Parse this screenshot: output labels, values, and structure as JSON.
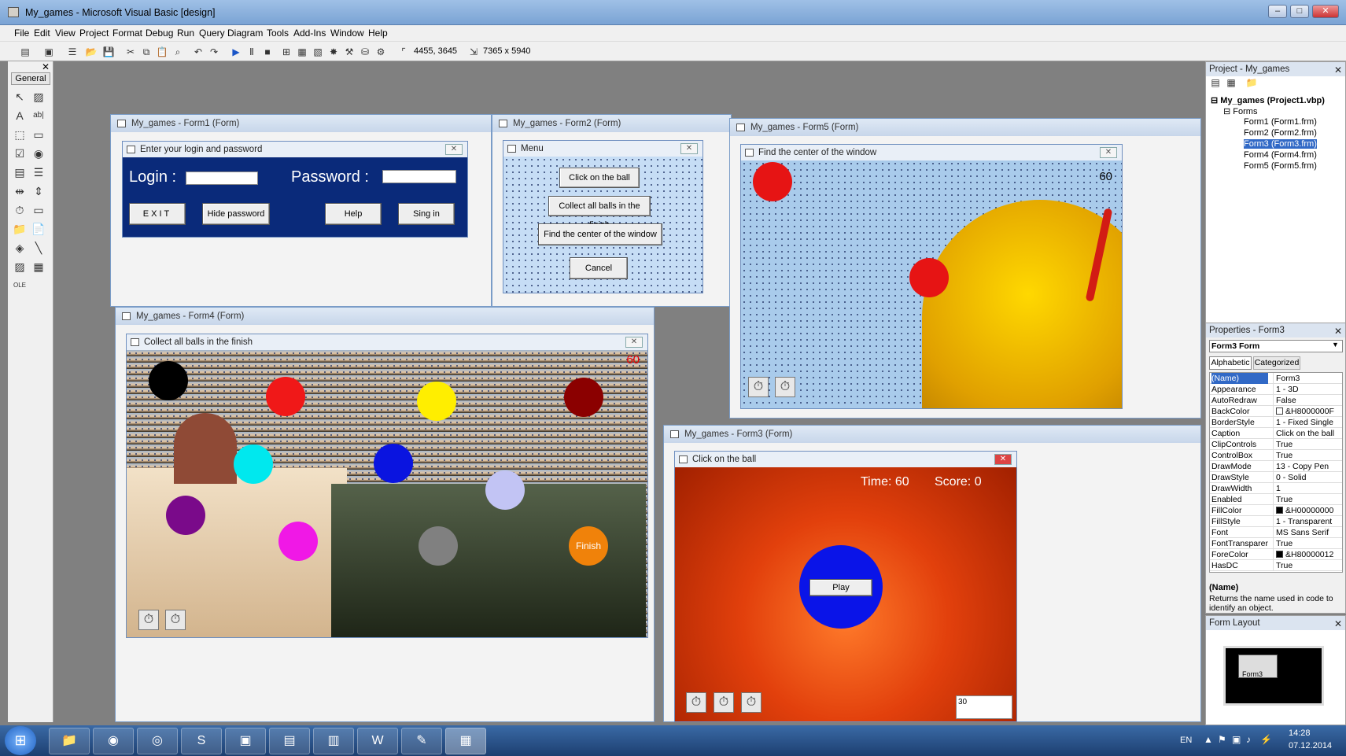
{
  "window": {
    "title": "My_games - Microsoft Visual Basic [design]",
    "min": "–",
    "max": "□",
    "close": "✕"
  },
  "menu": [
    "File",
    "Edit",
    "View",
    "Project",
    "Format",
    "Debug",
    "Run",
    "Query",
    "Diagram",
    "Tools",
    "Add-Ins",
    "Window",
    "Help"
  ],
  "toolbar": {
    "position": "4455, 3645",
    "size": "7365 x 5940"
  },
  "toolbox": {
    "title": "General"
  },
  "form1": {
    "outer": "My_games - Form1 (Form)",
    "caption": "Enter your login and password",
    "login_label": "Login :",
    "password_label": "Password :",
    "exit": "EXIT",
    "hide": "Hide password",
    "help": "Help",
    "sign": "Sing in"
  },
  "form2": {
    "outer": "My_games - Form2 (Form)",
    "caption": "Menu",
    "b1": "Click on the ball",
    "b2": "Collect all balls in the finish",
    "b3": "Find the center of the window",
    "b4": "Cancel"
  },
  "form5": {
    "outer": "My_games - Form5 (Form)",
    "caption": "Find the center of the window",
    "counter": "60"
  },
  "form4": {
    "outer": "My_games - Form4 (Form)",
    "caption": "Collect all balls in the finish",
    "counter": "60",
    "finish": "Finish"
  },
  "form3": {
    "outer": "My_games - Form3 (Form)",
    "caption": "Click on the ball",
    "time": "Time: 60",
    "score": "Score:  0",
    "play": "Play",
    "input": "30"
  },
  "project": {
    "title": "Project - My_games",
    "root": "My_games (Project1.vbp)",
    "folder": "Forms",
    "items": [
      "Form1 (Form1.frm)",
      "Form2 (Form2.frm)",
      "Form3 (Form3.frm)",
      "Form4 (Form4.frm)",
      "Form5 (Form5.frm)"
    ]
  },
  "properties": {
    "title": "Properties - Form3",
    "object": "Form3 Form",
    "tab1": "Alphabetic",
    "tab2": "Categorized",
    "rows": [
      [
        "(Name)",
        "Form3"
      ],
      [
        "Appearance",
        "1 - 3D"
      ],
      [
        "AutoRedraw",
        "False"
      ],
      [
        "BackColor",
        "&H8000000F"
      ],
      [
        "BorderStyle",
        "1 - Fixed Single"
      ],
      [
        "Caption",
        "Click on the ball"
      ],
      [
        "ClipControls",
        "True"
      ],
      [
        "ControlBox",
        "True"
      ],
      [
        "DrawMode",
        "13 - Copy Pen"
      ],
      [
        "DrawStyle",
        "0 - Solid"
      ],
      [
        "DrawWidth",
        "1"
      ],
      [
        "Enabled",
        "True"
      ],
      [
        "FillColor",
        "&H00000000"
      ],
      [
        "FillStyle",
        "1 - Transparent"
      ],
      [
        "Font",
        "MS Sans Serif"
      ],
      [
        "FontTransparent",
        "True"
      ],
      [
        "ForeColor",
        "&H80000012"
      ],
      [
        "HasDC",
        "True"
      ]
    ],
    "desc_title": "(Name)",
    "desc_text": "Returns the name used in code to identify an object."
  },
  "layout": {
    "title": "Form Layout",
    "form_label": "Form3"
  },
  "taskbar": {
    "lang": "EN",
    "time": "14:28",
    "date": "07.12.2014"
  }
}
